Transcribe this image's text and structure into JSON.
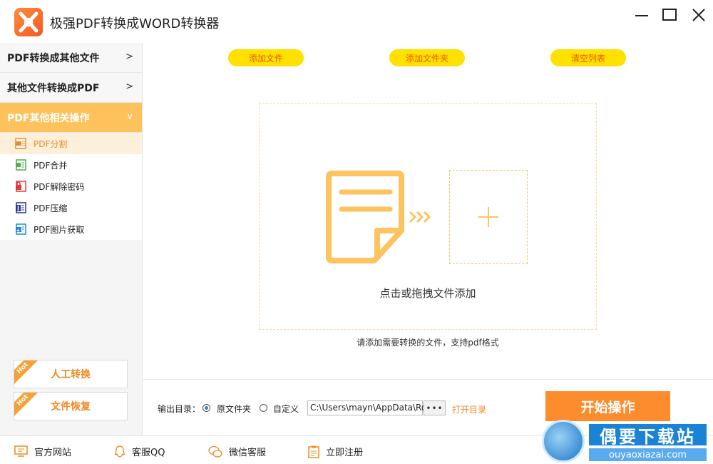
{
  "app": {
    "title": "极强PDF转换成WORD转换器"
  },
  "sidebar": {
    "categories": [
      {
        "label": "PDF转换成其他文件",
        "chevron": ">"
      },
      {
        "label": "其他文件转换成PDF",
        "chevron": ">"
      },
      {
        "label": "PDF其他相关操作",
        "chevron": "∨"
      }
    ],
    "items": [
      {
        "label": "PDF分割",
        "icon": "split-icon",
        "color": "#f08a24"
      },
      {
        "label": "PDF合并",
        "icon": "merge-icon",
        "color": "#4caf50"
      },
      {
        "label": "PDF解除密码",
        "icon": "unlock-icon",
        "color": "#e53935"
      },
      {
        "label": "PDF压缩",
        "icon": "compress-icon",
        "color": "#283593"
      },
      {
        "label": "PDF图片获取",
        "icon": "image-extract-icon",
        "color": "#1e88e5"
      }
    ],
    "hot_tag": "Hot",
    "manual_convert_label": "人工转换",
    "file_recovery_label": "文件恢复"
  },
  "toolbar": {
    "add_file": "添加文件",
    "add_folder": "添加文件夹",
    "clear_list": "清空列表"
  },
  "dropzone": {
    "text": "点击或拖拽文件添加",
    "hint": "请添加需要转换的文件，支持pdf格式"
  },
  "output": {
    "label": "输出目录：",
    "option_original": "原文件夹",
    "option_custom": "自定义",
    "selected": "原文件夹",
    "path": "C:\\Users\\mayn\\AppData\\Ro",
    "browse_label": "•••",
    "open_dir": "打开目录",
    "start": "开始操作"
  },
  "footer": {
    "website": "官方网站",
    "qq": "客服QQ",
    "wechat": "微信客服",
    "register": "立即注册"
  },
  "watermark": {
    "text": "偶要下载站",
    "url": "ouyaoxiazai.com"
  },
  "colors": {
    "accent": "#fd8c2c",
    "yellow_pill": "#ffe100",
    "active_category": "#fdc25c",
    "icon_orange": "#fcc35f"
  }
}
